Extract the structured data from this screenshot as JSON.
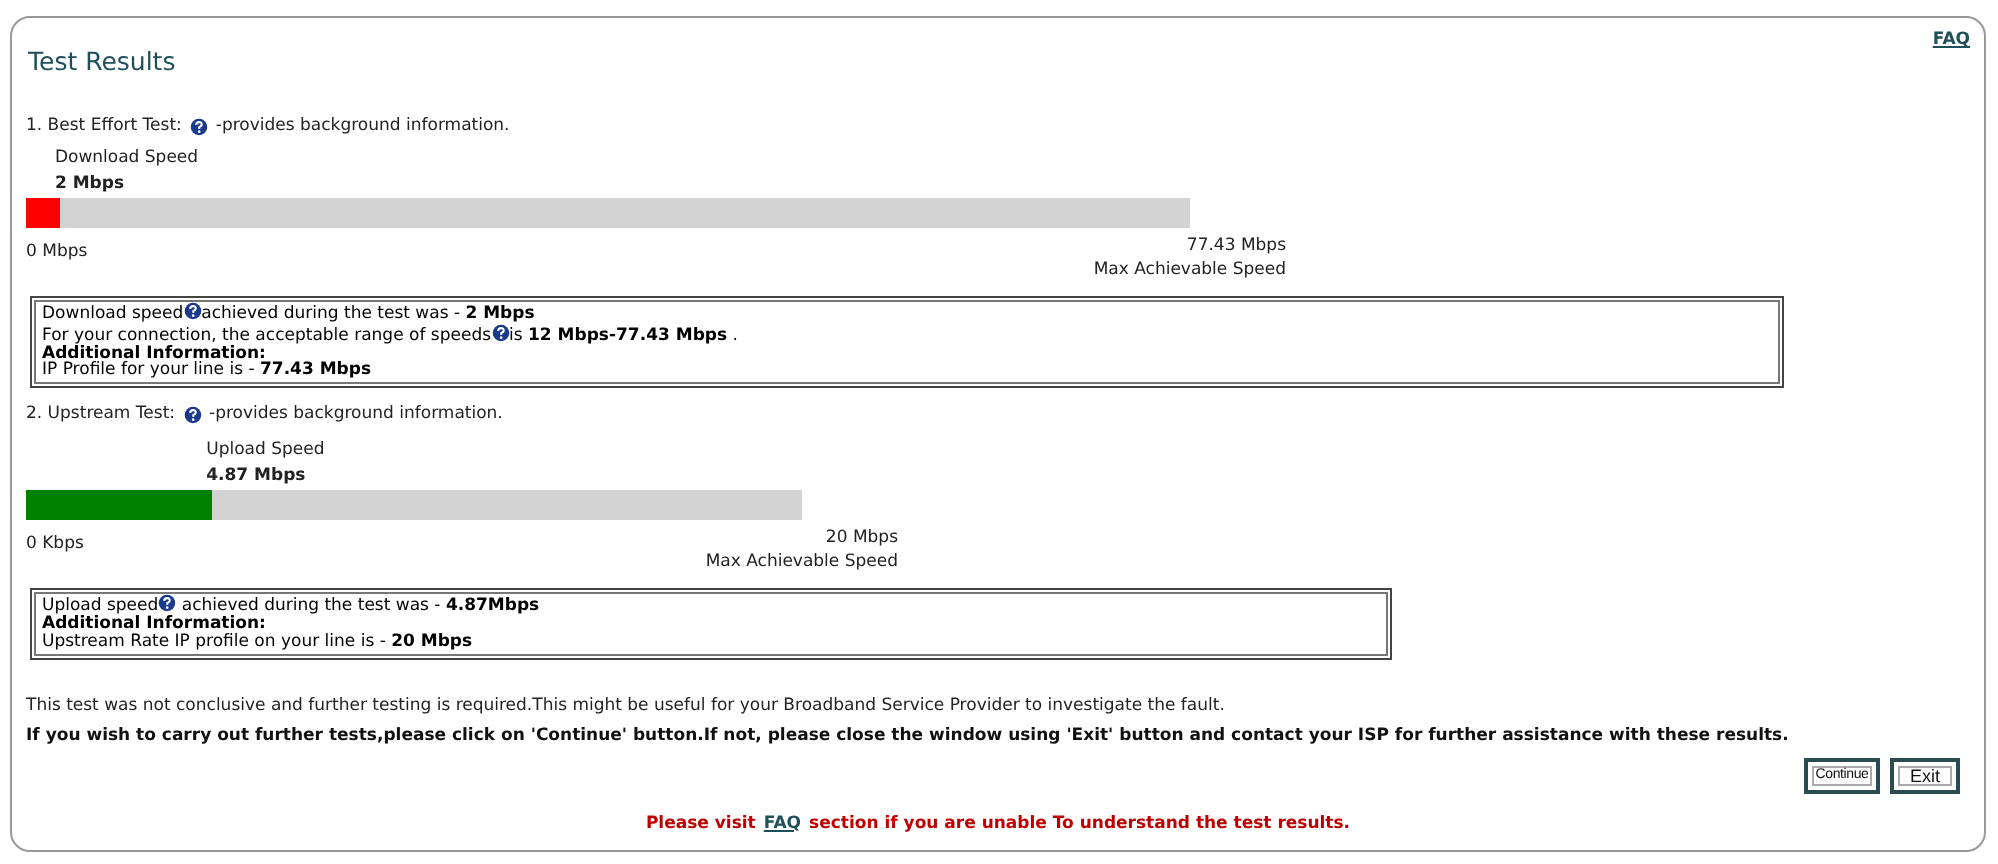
{
  "page": {
    "title": "Test Results",
    "faq_link": "FAQ"
  },
  "tests": [
    {
      "heading": "1. Best Effort Test:",
      "note": "-provides background information.",
      "meter": {
        "label": "Download Speed",
        "value": "2 Mbps",
        "level": 0.03,
        "color": "#ff0000",
        "min": "0 Mbps",
        "max": "77.43 Mbps",
        "max_caption": "Max Achievable Speed"
      },
      "info": [
        {
          "kind": "text",
          "parts": [
            {
              "kind": "text",
              "text": "Download speed"
            },
            {
              "kind": "help"
            },
            {
              "kind": "text",
              "text": "achieved during the test was - **2 Mbps**"
            }
          ]
        },
        {
          "kind": "text",
          "parts": [
            {
              "kind": "text",
              "text": "For your connection, the acceptable range of speeds"
            },
            {
              "kind": "help"
            },
            {
              "kind": "text",
              "text": "is **12 Mbps-77.43 Mbps** ."
            }
          ]
        },
        {
          "kind": "heading",
          "parts": [
            {
              "kind": "text",
              "text": "Additional Information:"
            }
          ]
        },
        {
          "kind": "text",
          "parts": [
            {
              "kind": "text",
              "text": "IP Profile for your line is - **77.43 Mbps**"
            }
          ]
        }
      ]
    },
    {
      "heading": "2. Upstream Test:",
      "note": "-provides background information.",
      "meter": {
        "label": "Upload Speed",
        "value": "4.87 Mbps",
        "level": 0.24,
        "color": "#008000",
        "min": "0 Kbps",
        "max": "20 Mbps",
        "max_caption": "Max Achievable Speed"
      },
      "info": [
        {
          "kind": "text",
          "parts": [
            {
              "kind": "text",
              "text": "Upload speed"
            },
            {
              "kind": "help"
            },
            {
              "kind": "text",
              "text": " achieved during the test was - **4.87Mbps**"
            }
          ]
        },
        {
          "kind": "heading",
          "parts": [
            {
              "kind": "text",
              "text": "Additional Information:"
            }
          ]
        },
        {
          "kind": "text",
          "parts": [
            {
              "kind": "text",
              "text": "Upstream Rate IP profile on your line is - **20 Mbps**"
            }
          ]
        }
      ]
    }
  ],
  "conclusion": "This test was not conclusive and further testing is required.This might be useful for your Broadband Service Provider to investigate the fault.",
  "instruction": "If you wish to carry out further tests,please click on 'Continue' button.If not, please close the window using 'Exit' button and contact your ISP for further assistance with these results.",
  "buttons": [
    {
      "label": "Continue"
    },
    {
      "label": "Exit"
    }
  ],
  "footer": {
    "before": "Please visit",
    "link": "FAQ",
    "after": "section if you are unable To understand the test results."
  }
}
